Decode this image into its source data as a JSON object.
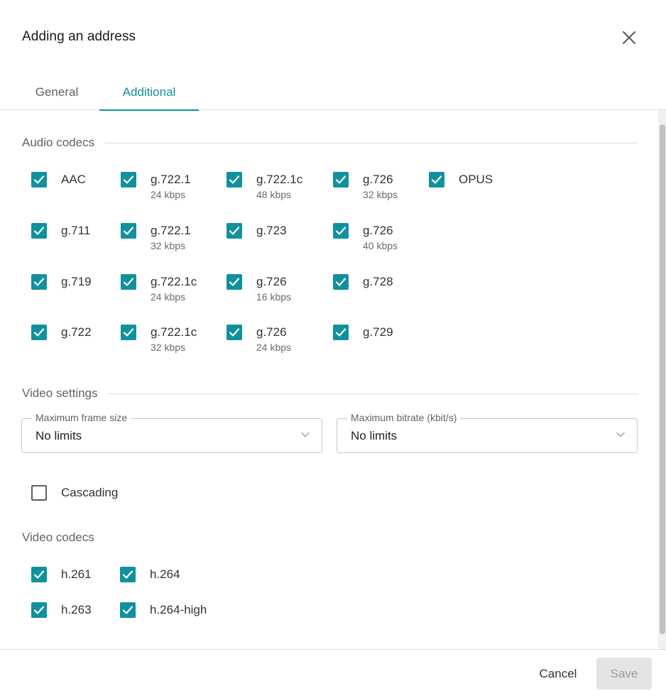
{
  "dialog": {
    "title": "Adding an address"
  },
  "tabs": [
    {
      "label": "General",
      "active": false
    },
    {
      "label": "Additional",
      "active": true
    }
  ],
  "audio_codecs": {
    "title": "Audio codecs",
    "items": [
      {
        "label": "AAC",
        "sub": "",
        "checked": true
      },
      {
        "label": "g.722.1",
        "sub": "24 kbps",
        "checked": true
      },
      {
        "label": "g.722.1c",
        "sub": "48 kbps",
        "checked": true
      },
      {
        "label": "g.726",
        "sub": "32 kbps",
        "checked": true
      },
      {
        "label": "OPUS",
        "sub": "",
        "checked": true
      },
      {
        "label": "g.711",
        "sub": "",
        "checked": true
      },
      {
        "label": "g.722.1",
        "sub": "32 kbps",
        "checked": true
      },
      {
        "label": "g.723",
        "sub": "",
        "checked": true
      },
      {
        "label": "g.726",
        "sub": "40 kbps",
        "checked": true
      },
      {
        "label": "g.719",
        "sub": "",
        "checked": true
      },
      {
        "label": "g.722.1c",
        "sub": "24 kbps",
        "checked": true
      },
      {
        "label": "g.726",
        "sub": "16 kbps",
        "checked": true
      },
      {
        "label": "g.728",
        "sub": "",
        "checked": true
      },
      {
        "label": "g.722",
        "sub": "",
        "checked": true
      },
      {
        "label": "g.722.1c",
        "sub": "32 kbps",
        "checked": true
      },
      {
        "label": "g.726",
        "sub": "24 kbps",
        "checked": true
      },
      {
        "label": "g.729",
        "sub": "",
        "checked": true
      }
    ]
  },
  "video_settings": {
    "title": "Video settings",
    "max_frame_size": {
      "label": "Maximum frame size",
      "value": "No limits"
    },
    "max_bitrate": {
      "label": "Maximum bitrate (kbit/s)",
      "value": "No limits"
    },
    "cascading": {
      "label": "Cascading",
      "checked": false
    }
  },
  "video_codecs": {
    "title": "Video codecs",
    "items": [
      {
        "label": "h.261",
        "checked": true
      },
      {
        "label": "h.264",
        "checked": true
      },
      {
        "label": "h.263",
        "checked": true
      },
      {
        "label": "h.264-high",
        "checked": true
      }
    ]
  },
  "footer": {
    "cancel_label": "Cancel",
    "save_label": "Save"
  },
  "colors": {
    "accent": "#11919e",
    "disabled_bg": "#e4e4e4",
    "disabled_text": "#9e9e9e"
  },
  "icons": {
    "close": "close-icon",
    "check": "check-icon",
    "chevron": "chevron-down-icon"
  }
}
